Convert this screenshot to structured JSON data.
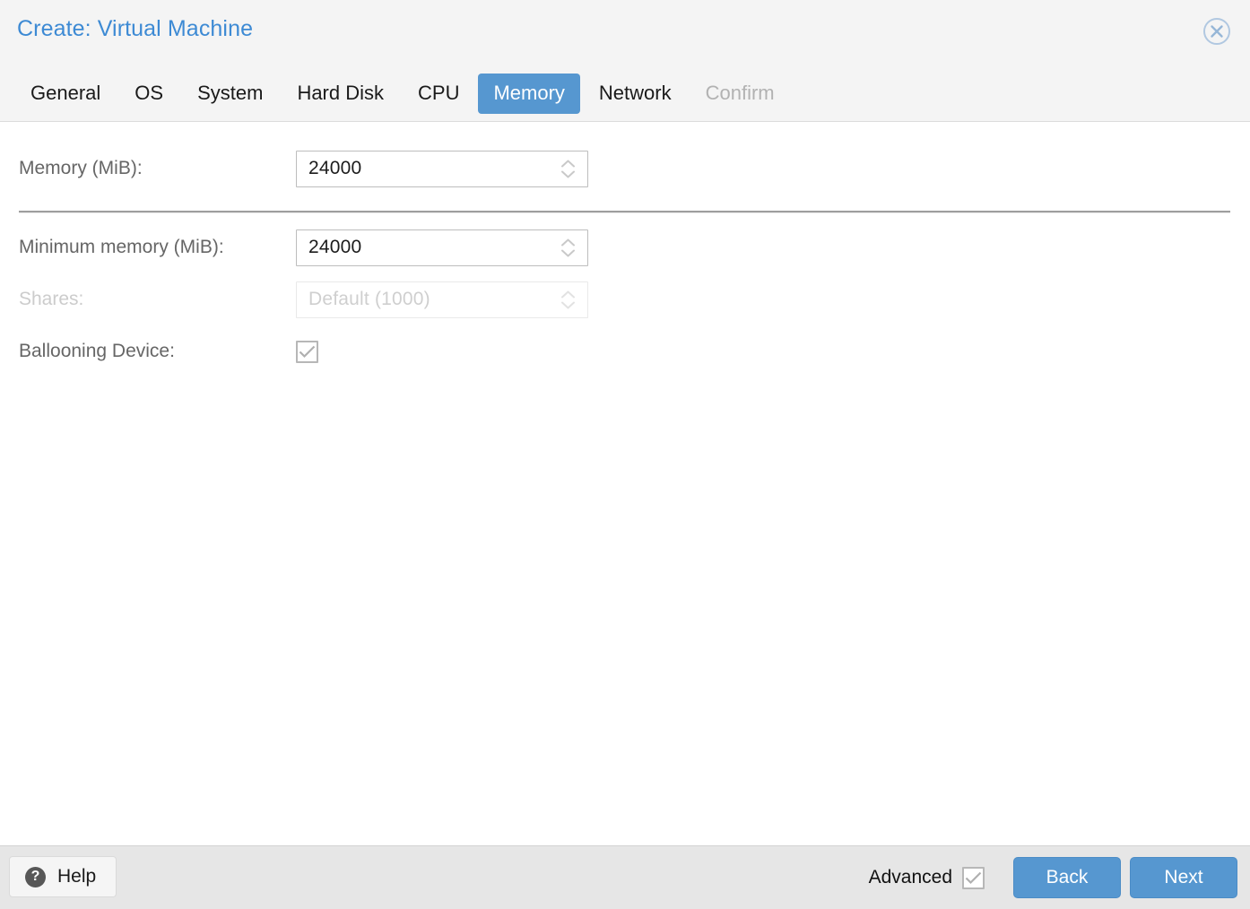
{
  "window": {
    "title": "Create: Virtual Machine",
    "close_icon": "close-circle-icon",
    "accent_color": "#5697d0",
    "title_color": "#3d8ad4"
  },
  "tabs": [
    {
      "label": "General",
      "state": "normal"
    },
    {
      "label": "OS",
      "state": "normal"
    },
    {
      "label": "System",
      "state": "normal"
    },
    {
      "label": "Hard Disk",
      "state": "normal"
    },
    {
      "label": "CPU",
      "state": "normal"
    },
    {
      "label": "Memory",
      "state": "active"
    },
    {
      "label": "Network",
      "state": "normal"
    },
    {
      "label": "Confirm",
      "state": "disabled"
    }
  ],
  "form": {
    "memory": {
      "label": "Memory (MiB):",
      "value": "24000",
      "placeholder": "",
      "disabled": false,
      "spinner_icon": "spinner-chevrons-icon"
    },
    "minimum_memory": {
      "label": "Minimum memory (MiB):",
      "value": "24000",
      "placeholder": "",
      "disabled": false,
      "spinner_icon": "spinner-chevrons-icon"
    },
    "shares": {
      "label": "Shares:",
      "value": "",
      "placeholder": "Default (1000)",
      "disabled": true,
      "spinner_icon": "spinner-chevrons-icon"
    },
    "ballooning_device": {
      "label": "Ballooning Device:",
      "checked": true,
      "check_icon": "checkmark-icon"
    }
  },
  "footer": {
    "help_label": "Help",
    "help_icon": "question-mark-circle-icon",
    "advanced_label": "Advanced",
    "advanced_checked": true,
    "back_label": "Back",
    "next_label": "Next"
  }
}
